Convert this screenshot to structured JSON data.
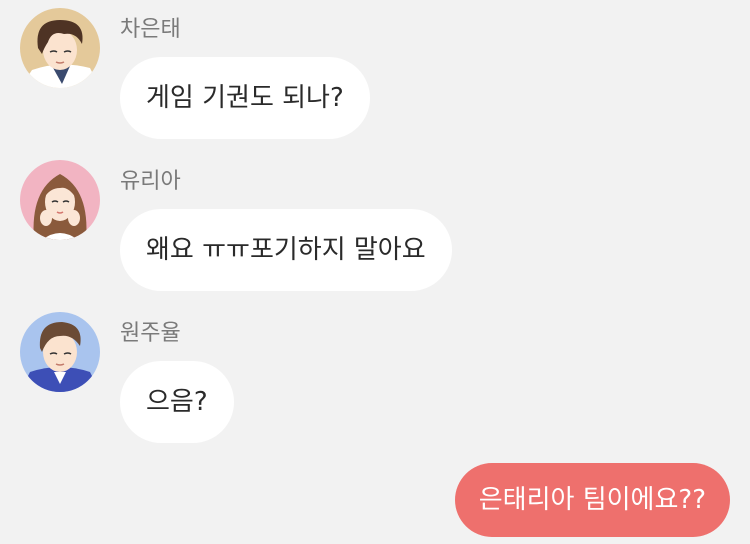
{
  "chat": {
    "messages": [
      {
        "sender": "차은태",
        "text": "게임 기권도 되나?",
        "avatar_icon": "man-brown-hair-avatar-icon"
      },
      {
        "sender": "유리아",
        "text": "왜요 ㅠㅠ포기하지 말아요",
        "avatar_icon": "woman-long-hair-avatar-icon"
      },
      {
        "sender": "원주율",
        "text": "으음?",
        "avatar_icon": "man-blue-shirt-avatar-icon"
      }
    ],
    "outgoing": {
      "text": "은태리아 팀이에요??"
    }
  },
  "colors": {
    "background": "#f2f2f2",
    "incoming_bubble": "#ffffff",
    "outgoing_bubble": "#ee706d",
    "sender_name": "#7a7a7a"
  }
}
